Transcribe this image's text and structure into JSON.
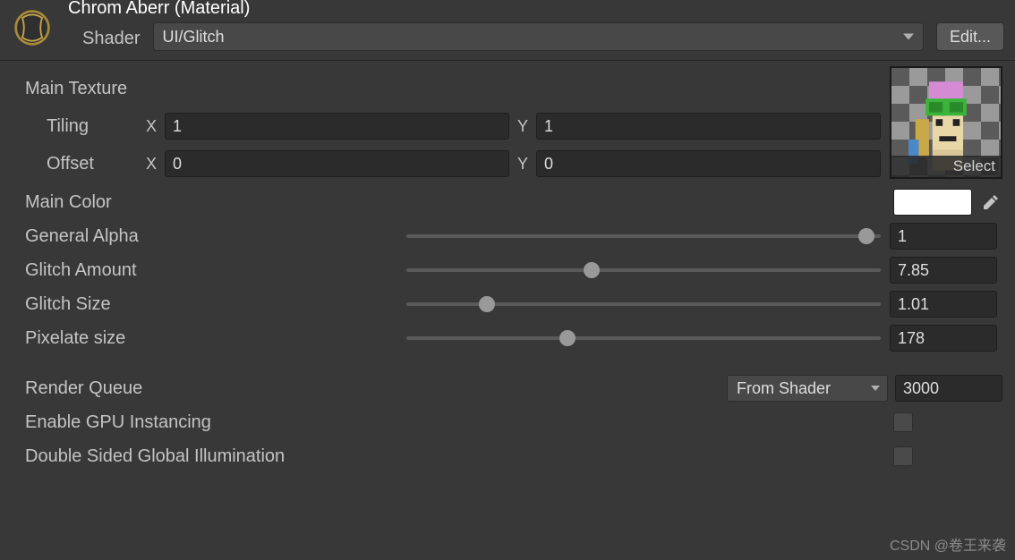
{
  "header": {
    "title": "Chrom Aberr  (Material)",
    "shader_label": "Shader",
    "shader_value": "UI/Glitch",
    "edit_label": "Edit..."
  },
  "main_texture": {
    "section_label": "Main Texture",
    "tiling_label": "Tiling",
    "offset_label": "Offset",
    "x_label": "X",
    "y_label": "Y",
    "tiling_x": "1",
    "tiling_y": "1",
    "offset_x": "0",
    "offset_y": "0",
    "select_label": "Select"
  },
  "props": {
    "main_color_label": "Main Color",
    "main_color_value": "#FFFFFF",
    "general_alpha_label": "General Alpha",
    "general_alpha_value": "1",
    "general_alpha_pct": 97,
    "glitch_amount_label": "Glitch Amount",
    "glitch_amount_value": "7.85",
    "glitch_amount_pct": 39,
    "glitch_size_label": "Glitch Size",
    "glitch_size_value": "1.01",
    "glitch_size_pct": 17,
    "pixelate_label": "Pixelate size",
    "pixelate_value": "178",
    "pixelate_pct": 34
  },
  "render": {
    "render_queue_label": "Render Queue",
    "render_queue_mode": "From Shader",
    "render_queue_value": "3000",
    "gpu_instancing_label": "Enable GPU Instancing",
    "double_sided_label": "Double Sided Global Illumination"
  },
  "watermark": "CSDN @卷王来袭"
}
